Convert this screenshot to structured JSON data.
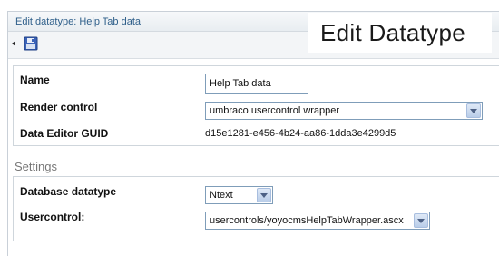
{
  "window": {
    "title": "Edit datatype: Help Tab data"
  },
  "overlay": {
    "label": "Edit Datatype"
  },
  "toolbar": {
    "save_icon": "save-icon",
    "back_icon": "collapse-arrow-icon"
  },
  "general": {
    "name_label": "Name",
    "name_value": "Help Tab data",
    "render_control_label": "Render control",
    "render_control_value": "umbraco usercontrol wrapper",
    "guid_label": "Data Editor GUID",
    "guid_value": "d15e1281-e456-4b24-aa86-1dda3e4299d5"
  },
  "settings": {
    "heading": "Settings",
    "database_datatype_label": "Database datatype",
    "database_datatype_value": "Ntext",
    "usercontrol_label": "Usercontrol:",
    "usercontrol_value": "usercontrols/yoyocmsHelpTabWrapper.ascx"
  }
}
